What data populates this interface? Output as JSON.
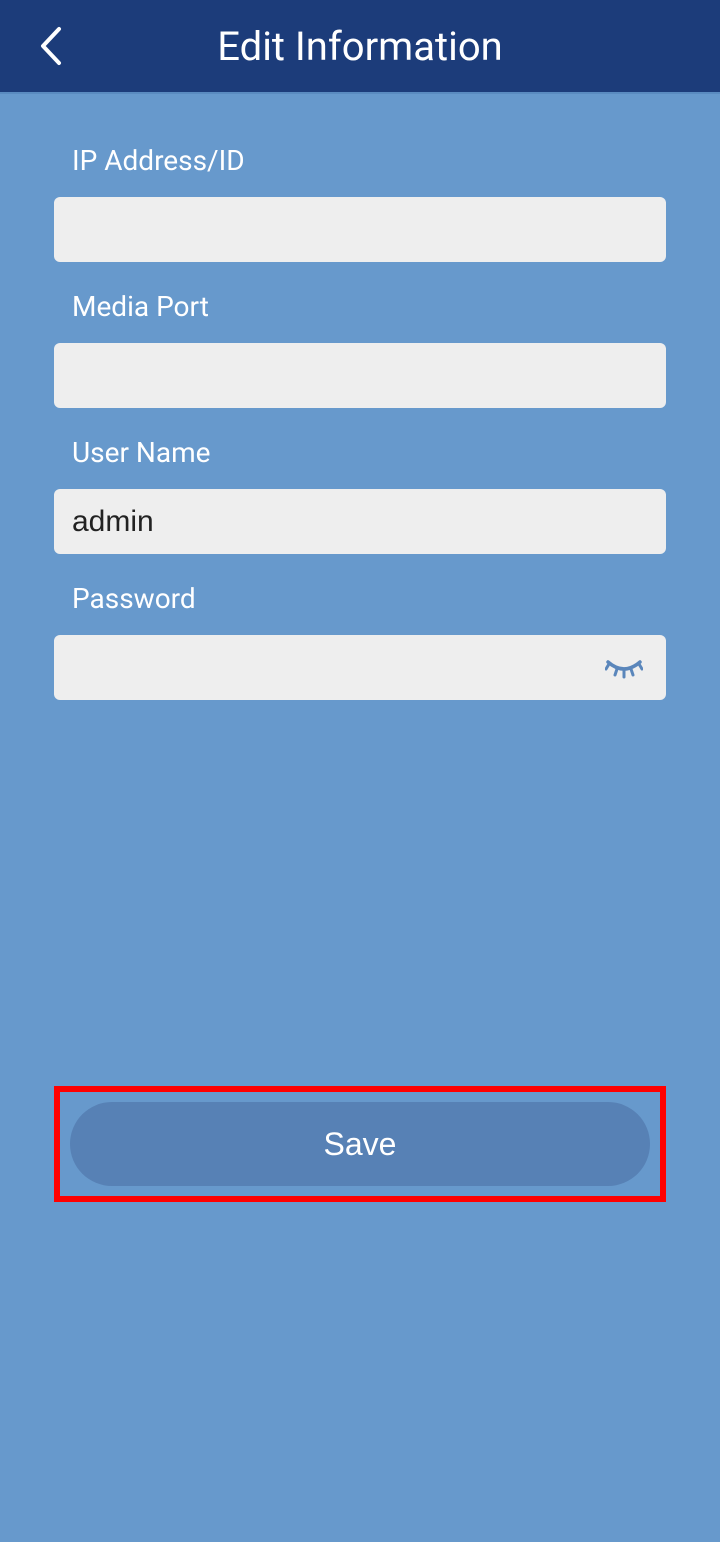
{
  "header": {
    "title": "Edit Information"
  },
  "form": {
    "ip_label": "IP Address/ID",
    "ip_value": "",
    "port_label": "Media Port",
    "port_value": "",
    "username_label": "User Name",
    "username_value": "admin",
    "password_label": "Password",
    "password_value": ""
  },
  "actions": {
    "save_label": "Save"
  }
}
